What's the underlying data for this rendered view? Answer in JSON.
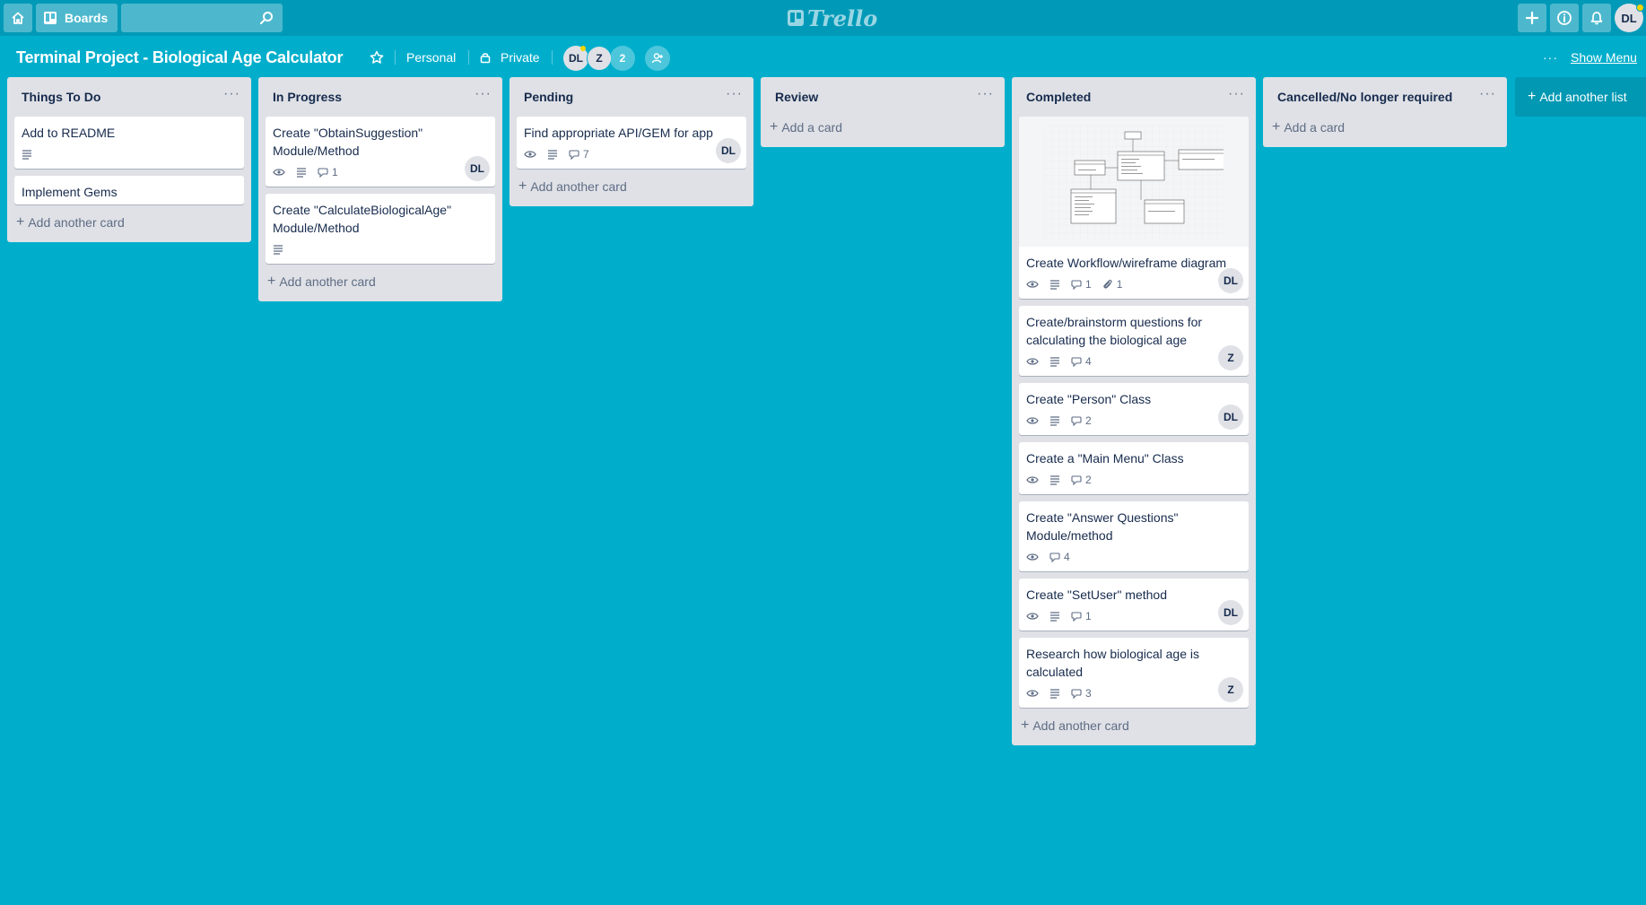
{
  "topbar": {
    "boards_label": "Boards",
    "search_placeholder": "",
    "logo_text": "Trello",
    "user_initials": "DL"
  },
  "board": {
    "title": "Terminal Project - Biological Age Calculator",
    "team": "Personal",
    "visibility": "Private",
    "members": [
      "DL",
      "Z"
    ],
    "extra_members": "2",
    "show_menu": "Show Menu"
  },
  "lists": [
    {
      "title": "Things To Do",
      "add_label": "Add another card",
      "cards": [
        {
          "title": "Add to README",
          "badges": {
            "description": true
          }
        },
        {
          "title": "Implement Gems",
          "badges": {}
        }
      ]
    },
    {
      "title": "In Progress",
      "add_label": "Add another card",
      "cards": [
        {
          "title": "Create \"ObtainSuggestion\" Module/Method",
          "badges": {
            "watch": true,
            "description": true,
            "comments": "1"
          },
          "member": "DL"
        },
        {
          "title": "Create \"CalculateBiologicalAge\" Module/Method",
          "badges": {
            "description": true
          }
        }
      ]
    },
    {
      "title": "Pending",
      "add_label": "Add another card",
      "cards": [
        {
          "title": "Find appropriate API/GEM for app",
          "badges": {
            "watch": true,
            "description": true,
            "comments": "7"
          },
          "member": "DL"
        }
      ]
    },
    {
      "title": "Review",
      "add_label": "Add a card",
      "cards": []
    },
    {
      "title": "Completed",
      "add_label": "Add another card",
      "cards": [
        {
          "title": "Create Workflow/wireframe diagram",
          "cover": true,
          "badges": {
            "watch": true,
            "description": true,
            "comments": "1",
            "attachments": "1"
          },
          "member": "DL"
        },
        {
          "title": "Create/brainstorm questions for calculating the biological age",
          "badges": {
            "watch": true,
            "description": true,
            "comments": "4"
          },
          "member": "Z"
        },
        {
          "title": "Create \"Person\" Class",
          "badges": {
            "watch": true,
            "description": true,
            "comments": "2"
          },
          "member": "DL"
        },
        {
          "title": "Create a \"Main Menu\" Class",
          "badges": {
            "watch": true,
            "description": true,
            "comments": "2"
          }
        },
        {
          "title": "Create \"Answer Questions\" Module/method",
          "badges": {
            "watch": true,
            "comments": "4"
          }
        },
        {
          "title": "Create \"SetUser\" method",
          "badges": {
            "watch": true,
            "description": true,
            "comments": "1"
          },
          "member": "DL"
        },
        {
          "title": "Research how biological age is calculated",
          "badges": {
            "watch": true,
            "description": true,
            "comments": "3"
          },
          "member": "Z"
        }
      ]
    },
    {
      "title": "Cancelled/No longer required",
      "add_label": "Add a card",
      "cards": []
    }
  ],
  "add_list_label": "Add another list",
  "colors": {
    "background": "#00aecc",
    "topbar": "#009ab8",
    "list_bg": "#dfe1e6",
    "member_badge": "#dfe1e6"
  }
}
